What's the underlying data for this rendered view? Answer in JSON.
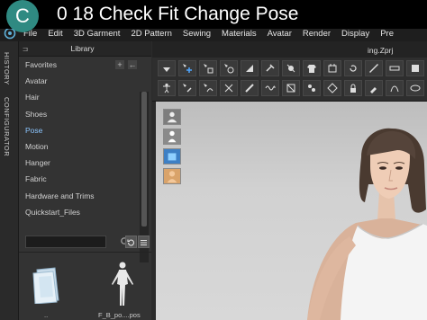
{
  "overlay": {
    "badge": "C",
    "title": "0 18 Check Fit Change Pose"
  },
  "menubar": {
    "items": [
      "File",
      "Edit",
      "3D Garment",
      "2D Pattern",
      "Sewing",
      "Materials",
      "Avatar",
      "Render",
      "Display",
      "Pre"
    ]
  },
  "sidetabs": {
    "history": "HISTORY",
    "configurator": "CONFIGURATOR"
  },
  "library": {
    "title": "Library",
    "items": [
      {
        "label": "Favorites"
      },
      {
        "label": "Avatar"
      },
      {
        "label": "Hair"
      },
      {
        "label": "Shoes"
      },
      {
        "label": "Pose"
      },
      {
        "label": "Motion"
      },
      {
        "label": "Hanger"
      },
      {
        "label": "Fabric"
      },
      {
        "label": "Hardware and Trims"
      },
      {
        "label": "Quickstart_Files"
      }
    ],
    "active": "Pose",
    "add_symbol": "+",
    "back_symbol": "←",
    "thumbs": [
      {
        "label": ".."
      },
      {
        "label": "F_B_po....pos"
      }
    ]
  },
  "document": {
    "tab_label": "ing.Zprj"
  },
  "colors": {
    "accent_active": "#8cc6ff",
    "badge": "#2f8a82",
    "viewport": "#d1d1d1"
  }
}
